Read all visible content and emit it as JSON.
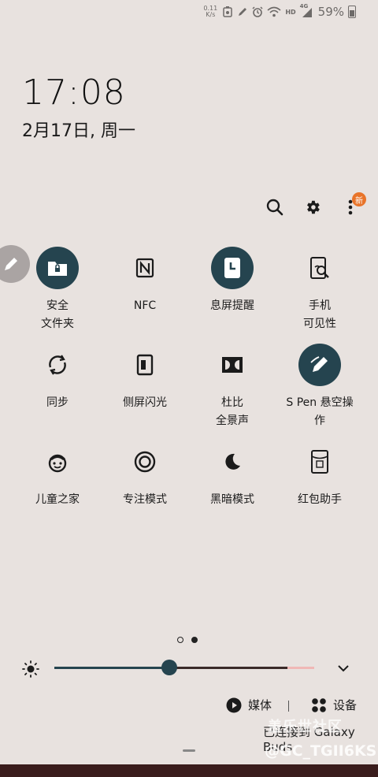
{
  "status_bar": {
    "net_speed_value": "0.11",
    "net_speed_unit": "K/s",
    "wifi_tag": "HD",
    "network_tag": "4G",
    "battery_percent": "59%"
  },
  "clock": {
    "time": "17:08",
    "date": "2月17日, 周一"
  },
  "panel": {
    "settings_badge": "新"
  },
  "tiles": [
    {
      "label": "安全\n文件夹",
      "icon": "secure-folder-icon",
      "active": true
    },
    {
      "label": "NFC",
      "icon": "nfc-icon",
      "active": false
    },
    {
      "label": "息屏提醒",
      "icon": "always-on-display-icon",
      "active": true
    },
    {
      "label": "手机\n可见性",
      "icon": "phone-visibility-icon",
      "active": false
    },
    {
      "label": "同步",
      "icon": "sync-icon",
      "active": false
    },
    {
      "label": "侧屏闪光",
      "icon": "edge-lighting-icon",
      "active": false
    },
    {
      "label": "杜比\n全景声",
      "icon": "dolby-atmos-icon",
      "active": false
    },
    {
      "label": "S Pen 悬空操\n作",
      "icon": "s-pen-icon",
      "active": true
    },
    {
      "label": "儿童之家",
      "icon": "kids-home-icon",
      "active": false
    },
    {
      "label": "专注模式",
      "icon": "focus-mode-icon",
      "active": false
    },
    {
      "label": "黑暗模式",
      "icon": "dark-mode-icon",
      "active": false
    },
    {
      "label": "红包助手",
      "icon": "red-envelope-icon",
      "active": false
    }
  ],
  "pager": {
    "pages": 2,
    "current": 2
  },
  "brightness": {
    "level": 0.48
  },
  "media": {
    "media_label": "媒体",
    "devices_label": "设备"
  },
  "connected_text": "已连接到 Galaxy Buds",
  "watermark": {
    "line1": "盖乐世社区",
    "line2": "@GC_TGII6KS"
  },
  "colors": {
    "accent": "#25444f",
    "background": "#e8e2df",
    "badge": "#e8742a"
  }
}
